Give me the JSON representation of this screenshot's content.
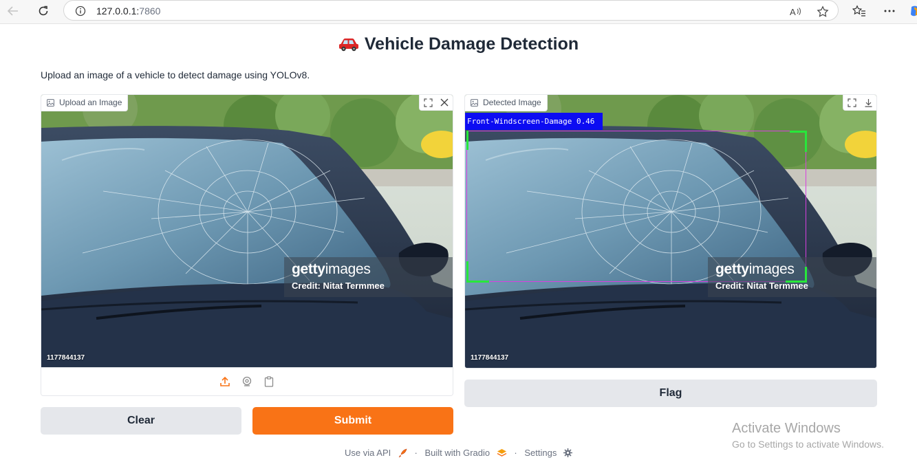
{
  "browser": {
    "url_host": "127.0.0.1:",
    "url_port": "7860",
    "read_aloud_icon": "read-aloud-icon",
    "favorite_icon": "star-icon"
  },
  "page": {
    "title": "Vehicle Damage Detection",
    "title_emoji": "🚗",
    "description": "Upload an image of a vehicle to detect damage using YOLOv8."
  },
  "input_panel": {
    "label": "Upload an Image",
    "watermark_logo_a": "getty",
    "watermark_logo_b": "images",
    "watermark_credit": "Credit: Nitat Termmee",
    "image_id": "1177844137"
  },
  "output_panel": {
    "label": "Detected Image",
    "detection_label": "Front-Windscreen-Damage 0.46",
    "watermark_logo_a": "getty",
    "watermark_logo_b": "images",
    "watermark_credit": "Credit: Nitat Termmee",
    "image_id": "1177844137"
  },
  "buttons": {
    "clear": "Clear",
    "submit": "Submit",
    "flag": "Flag"
  },
  "footer": {
    "api": "Use via API",
    "built": "Built with Gradio",
    "settings": "Settings"
  },
  "os_overlay": {
    "heading": "Activate Windows",
    "sub": "Go to Settings to activate Windows."
  },
  "colors": {
    "accent": "#f97316",
    "detection_box": "#d93fe0",
    "detection_label_bg": "#0c0cf2",
    "corner_marks": "#27e83a"
  }
}
